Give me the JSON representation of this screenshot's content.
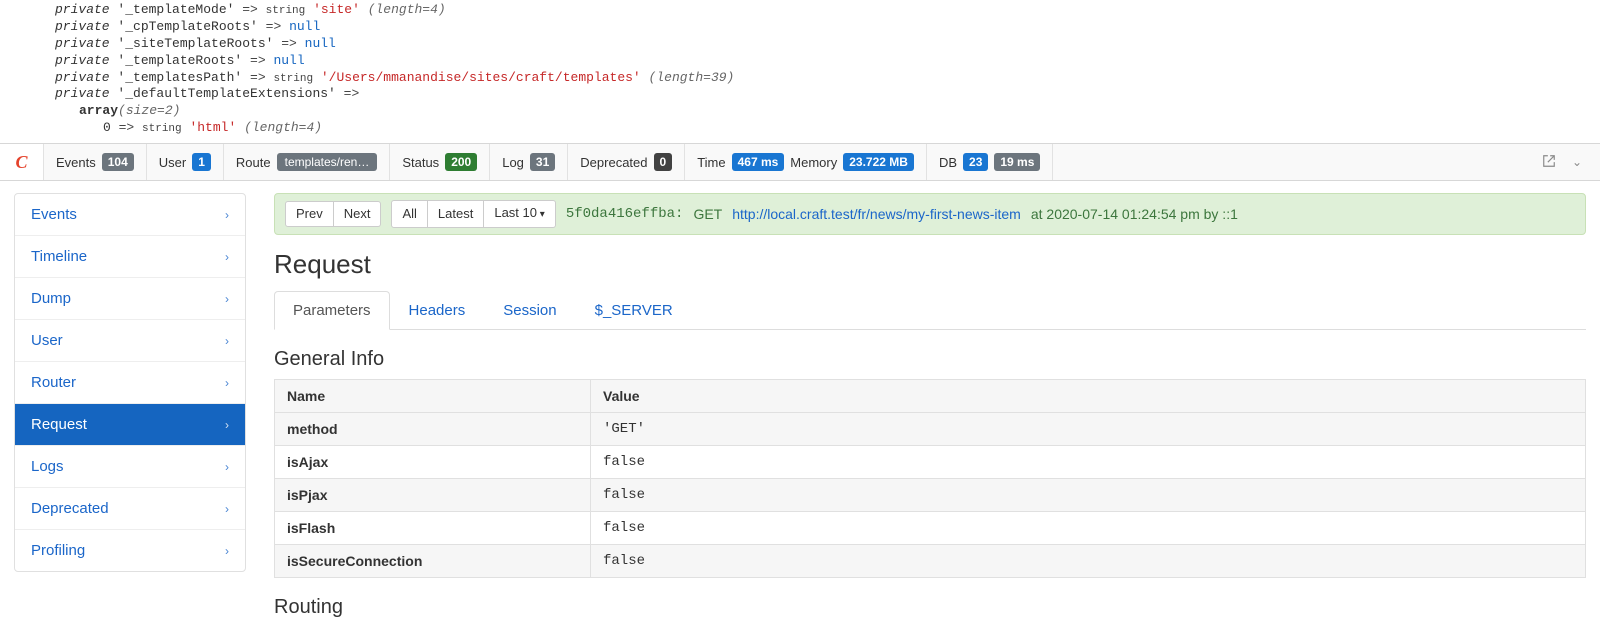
{
  "dump": {
    "lines": [
      {
        "indent": 0,
        "kw": "private",
        "key": "'_templateMode'",
        "arrow": " => ",
        "type": "string",
        "value": "'site'",
        "meta": "(length=4)",
        "valueClass": "str"
      },
      {
        "indent": 0,
        "kw": "private",
        "key": "'_cpTemplateRoots'",
        "arrow": " => ",
        "type": "",
        "value": "null",
        "meta": "",
        "valueClass": "nul"
      },
      {
        "indent": 0,
        "kw": "private",
        "key": "'_siteTemplateRoots'",
        "arrow": " => ",
        "type": "",
        "value": "null",
        "meta": "",
        "valueClass": "nul"
      },
      {
        "indent": 0,
        "kw": "private",
        "key": "'_templateRoots'",
        "arrow": " => ",
        "type": "",
        "value": "null",
        "meta": "",
        "valueClass": "nul"
      },
      {
        "indent": 0,
        "kw": "private",
        "key": "'_templatesPath'",
        "arrow": " => ",
        "type": "string",
        "value": "'/Users/mmanandise/sites/craft/templates'",
        "meta": "(length=39)",
        "valueClass": "str"
      },
      {
        "indent": 0,
        "kw": "private",
        "key": "'_defaultTemplateExtensions'",
        "arrow": " => ",
        "type": "",
        "value": "",
        "meta": "",
        "valueClass": ""
      },
      {
        "indent": 1,
        "kw": "",
        "key": "array",
        "arrow": "",
        "type": "",
        "value": "",
        "meta": "(size=2)",
        "valueClass": "",
        "keyBold": true
      },
      {
        "indent": 2,
        "kw": "",
        "key": "0",
        "arrow": " => ",
        "type": "string",
        "value": "'html'",
        "meta": "(length=4)",
        "valueClass": "str"
      }
    ]
  },
  "toolbar": {
    "logo": "C",
    "items": [
      {
        "label": "Events",
        "badges": [
          {
            "text": "104",
            "cls": "badge-gray"
          }
        ]
      },
      {
        "label": "User",
        "badges": [
          {
            "text": "1",
            "cls": "badge-blue"
          }
        ]
      },
      {
        "label": "Route",
        "route": "templates/ren…"
      },
      {
        "label": "Status",
        "badges": [
          {
            "text": "200",
            "cls": "badge-green"
          }
        ]
      },
      {
        "label": "Log",
        "badges": [
          {
            "text": "31",
            "cls": "badge-gray"
          }
        ]
      },
      {
        "label": "Deprecated",
        "badges": [
          {
            "text": "0",
            "cls": "badge-dark"
          }
        ]
      },
      {
        "label": "Time",
        "badges": [
          {
            "text": "467 ms",
            "cls": "badge-blue"
          }
        ],
        "label2": "Memory",
        "badges2": [
          {
            "text": "23.722 MB",
            "cls": "badge-blue"
          }
        ]
      },
      {
        "label": "DB",
        "badges": [
          {
            "text": "23",
            "cls": "badge-blue"
          },
          {
            "text": "19 ms",
            "cls": "badge-gray"
          }
        ]
      }
    ]
  },
  "sidebar": {
    "items": [
      {
        "label": "Events",
        "active": false
      },
      {
        "label": "Timeline",
        "active": false
      },
      {
        "label": "Dump",
        "active": false
      },
      {
        "label": "User",
        "active": false
      },
      {
        "label": "Router",
        "active": false
      },
      {
        "label": "Request",
        "active": true
      },
      {
        "label": "Logs",
        "active": false
      },
      {
        "label": "Deprecated",
        "active": false
      },
      {
        "label": "Profiling",
        "active": false
      }
    ]
  },
  "statusbar": {
    "nav": {
      "prev": "Prev",
      "next": "Next",
      "all": "All",
      "latest": "Latest",
      "lastN": "Last 10"
    },
    "hash": "5f0da416effba:",
    "method": "GET",
    "url": "http://local.craft.test/fr/news/my-first-news-item",
    "tail": "at 2020-07-14 01:24:54 pm by ::1"
  },
  "main": {
    "title": "Request",
    "tabs": [
      {
        "label": "Parameters",
        "active": true
      },
      {
        "label": "Headers",
        "active": false
      },
      {
        "label": "Session",
        "active": false
      },
      {
        "label": "$_SERVER",
        "active": false
      }
    ],
    "general": {
      "heading": "General Info",
      "cols": [
        "Name",
        "Value"
      ],
      "rows": [
        {
          "name": "method",
          "value": "'GET'"
        },
        {
          "name": "isAjax",
          "value": "false"
        },
        {
          "name": "isPjax",
          "value": "false"
        },
        {
          "name": "isFlash",
          "value": "false"
        },
        {
          "name": "isSecureConnection",
          "value": "false"
        }
      ]
    },
    "routingHeading": "Routing"
  }
}
